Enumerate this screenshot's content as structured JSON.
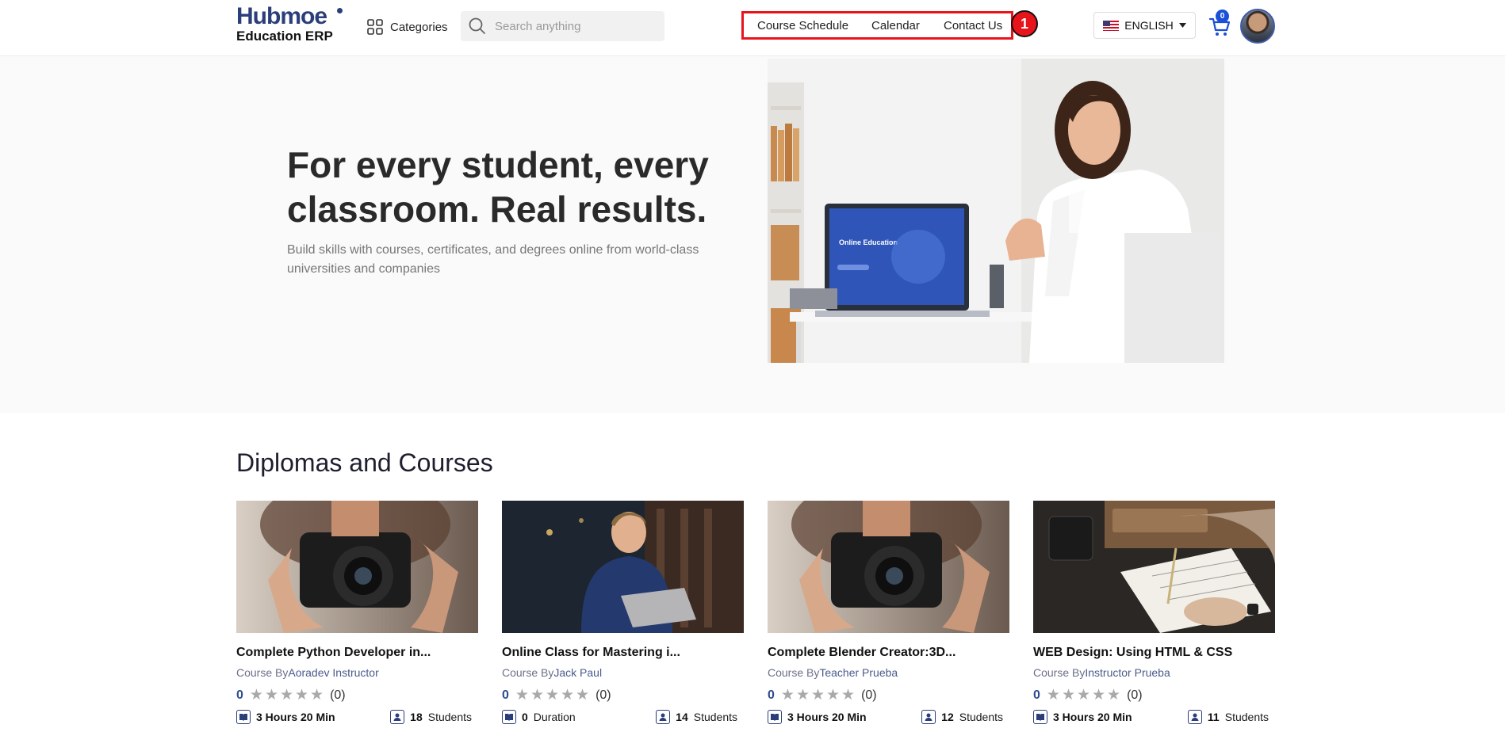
{
  "header": {
    "logo_top": "Hubmoe",
    "logo_bottom": "Education ERP",
    "categories_label": "Categories",
    "search_placeholder": "Search anything",
    "nav": [
      "Course Schedule",
      "Calendar",
      "Contact Us"
    ],
    "annotation_badge": "1",
    "language": "ENGLISH",
    "cart_count": "0",
    "accent_color": "#e8141c"
  },
  "hero": {
    "title": "For every student, every classroom. Real results.",
    "subtitle": "Build skills with courses, certificates, and degrees online from world-class universities and companies",
    "laptop_screen_text": "Online Education"
  },
  "courses": {
    "title": "Diplomas and Courses",
    "items": [
      {
        "title": "Complete Python Developer in...",
        "by_prefix": "Course By",
        "instructor": "Aoradev Instructor",
        "rating": "0",
        "rating_count": "(0)",
        "duration_value": "3 Hours 20 Min",
        "duration_suffix": "",
        "students_value": "18",
        "students_label": "Students",
        "image": "camera-photographer"
      },
      {
        "title": "Online Class for Mastering i...",
        "by_prefix": "Course By",
        "instructor": "Jack Paul",
        "rating": "0",
        "rating_count": "(0)",
        "duration_value": "0",
        "duration_suffix": "Duration",
        "students_value": "14",
        "students_label": "Students",
        "image": "man-with-laptop"
      },
      {
        "title": "Complete Blender Creator:3D...",
        "by_prefix": "Course By",
        "instructor": "Teacher Prueba",
        "rating": "0",
        "rating_count": "(0)",
        "duration_value": "3 Hours 20 Min",
        "duration_suffix": "",
        "students_value": "12",
        "students_label": "Students",
        "image": "camera-photographer"
      },
      {
        "title": "WEB Design: Using HTML & CSS",
        "by_prefix": "Course By",
        "instructor": "Instructor Prueba",
        "rating": "0",
        "rating_count": "(0)",
        "duration_value": "3 Hours 20 Min",
        "duration_suffix": "",
        "students_value": "11",
        "students_label": "Students",
        "image": "hand-writing-notebook"
      }
    ]
  }
}
